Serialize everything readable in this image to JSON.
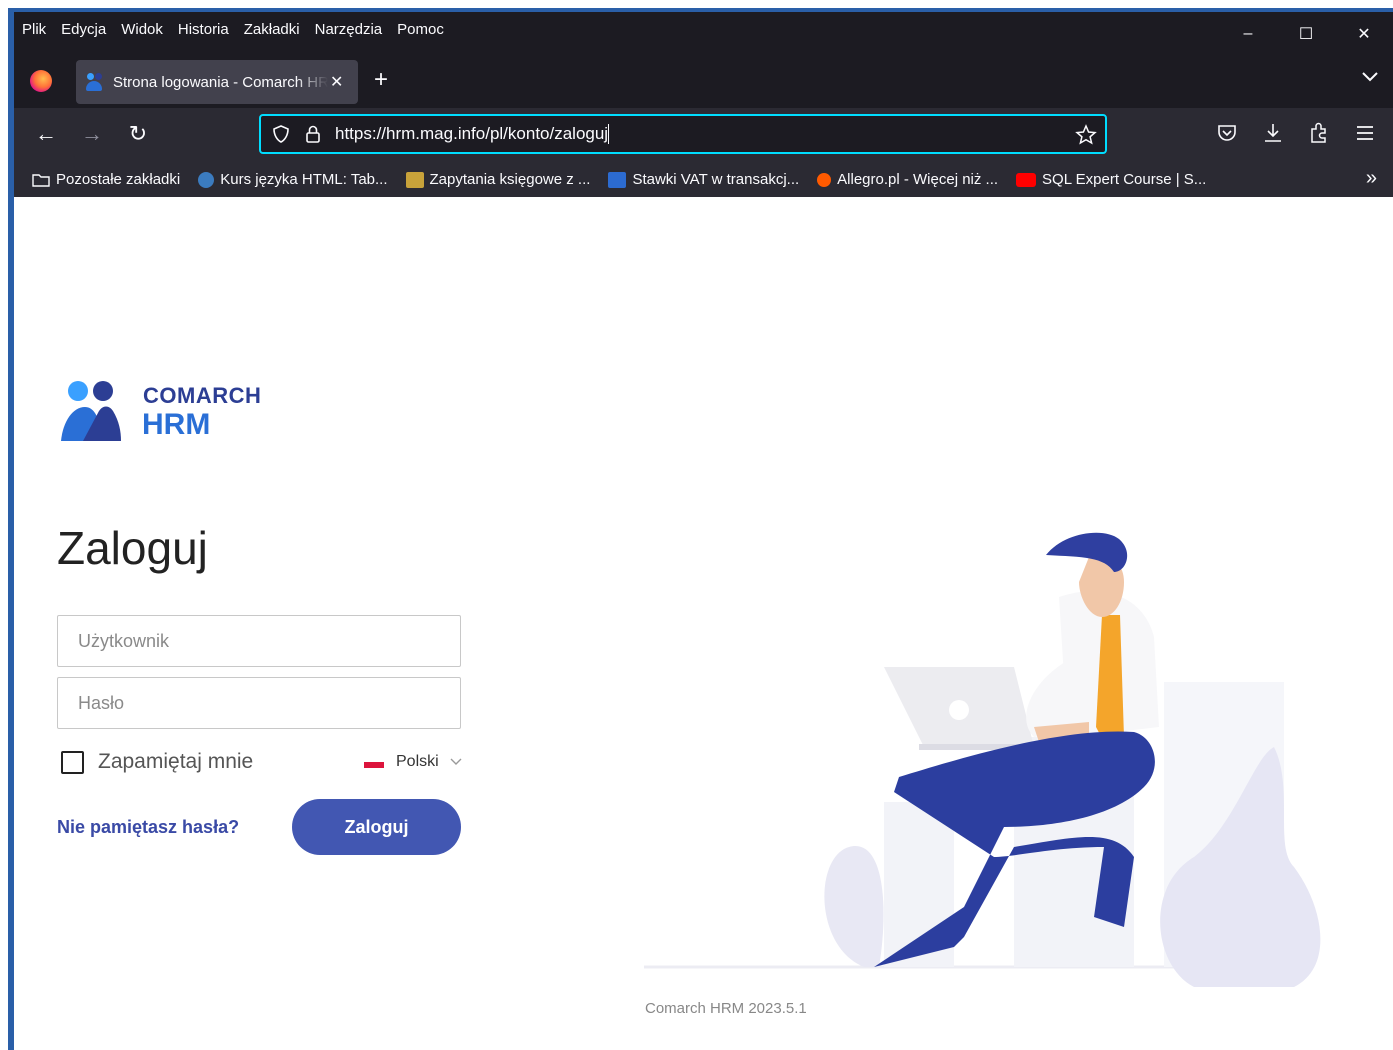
{
  "menubar": {
    "items": [
      {
        "label": "Plik"
      },
      {
        "label": "Edycja"
      },
      {
        "label": "Widok"
      },
      {
        "label": "Historia"
      },
      {
        "label": "Zakładki"
      },
      {
        "label": "Narzędzia"
      },
      {
        "label": "Pomoc"
      }
    ]
  },
  "window_controls": {
    "minimize": "–",
    "maximize": "☐",
    "close": "✕"
  },
  "tab": {
    "title": "Strona logowania - Comarch HRM",
    "close": "✕"
  },
  "newtab": "+",
  "tablist": "⌄",
  "nav": {
    "back": "←",
    "forward": "→",
    "reload": "↻"
  },
  "urlbar": {
    "url": "https://hrm.mag.info/pl/konto/zaloguj"
  },
  "bookmarks": {
    "items": [
      {
        "label": "Pozostałe zakładki",
        "icon": "folder-icon",
        "color": "#fbfbfe"
      },
      {
        "label": "Kurs języka HTML: Tab...",
        "icon": "site-icon",
        "color": "#3b7bbf"
      },
      {
        "label": "Zapytania księgowe z ...",
        "icon": "site-icon",
        "color": "#c8a23a"
      },
      {
        "label": "Stawki VAT w transakcj...",
        "icon": "site-icon",
        "color": "#2c6bd1"
      },
      {
        "label": "Allegro.pl - Więcej niż ...",
        "icon": "allegro-icon",
        "color": "#ff5a00"
      },
      {
        "label": "SQL Expert Course | S...",
        "icon": "youtube-icon",
        "color": "#ff0000"
      }
    ],
    "more": "»"
  },
  "brand": {
    "line1": "COMARCH",
    "line2": "HRM",
    "colors": {
      "dark": "#2c3e94",
      "light": "#2a6fd6"
    }
  },
  "login": {
    "heading": "Zaloguj",
    "username_placeholder": "Użytkownik",
    "password_placeholder": "Hasło",
    "remember_label": "Zapamiętaj mnie",
    "remember_checked": false,
    "language": "Polski",
    "forgot_label": "Nie pamiętasz hasła?",
    "submit_label": "Zaloguj",
    "accent": "#4257b2"
  },
  "footer": {
    "version": "Comarch HRM 2023.5.1"
  }
}
